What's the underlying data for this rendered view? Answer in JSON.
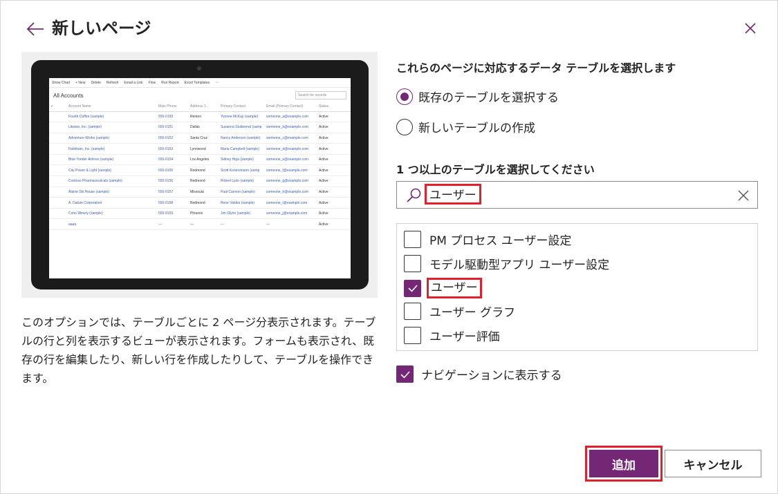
{
  "dialog": {
    "title": "新しいページ"
  },
  "preview": {
    "toolbar": [
      "Show Chart",
      "+ New",
      "Delete",
      "Refresh",
      "Email a Link",
      "Flow",
      "Run Report",
      "Excel Templates",
      "···"
    ],
    "view_title": "All Accounts",
    "search_placeholder": "Search for records",
    "columns": [
      "Account Name",
      "Main Phone",
      "Address 1...",
      "Primary Contact",
      "Email (Primary Contact)",
      "Status"
    ],
    "rows": [
      [
        "Fourth Coffee (sample)",
        "555-0150",
        "Renton",
        "Yvonne McKay (sample)",
        "someone_a@example.com",
        "Active"
      ],
      [
        "Litware, Inc. (sample)",
        "555-0151",
        "Dallas",
        "Susanna Stubberod (samp",
        "someone_b@example.com",
        "Active"
      ],
      [
        "Adventure Works (sample)",
        "555-0152",
        "Santa Cruz",
        "Nancy Anderson (sample)",
        "someone_c@example.com",
        "Active"
      ],
      [
        "Fabrikam, Inc. (sample)",
        "555-0153",
        "Lynnwood",
        "Maria Campbell (sample)",
        "someone_d@example.com",
        "Active"
      ],
      [
        "Blue Yonder Airlines (sample)",
        "555-0154",
        "Los Angeles",
        "Sidney Higa (sample)",
        "someone_e@example.com",
        "Active"
      ],
      [
        "City Power & Light (sample)",
        "555-0155",
        "Redmond",
        "Scott Konersmann (samp",
        "someone_f@example.com",
        "Active"
      ],
      [
        "Contoso Pharmaceuticals (sample)",
        "555-0156",
        "Redmond",
        "Robert Lyon (sample)",
        "someone_g@example.com",
        "Active"
      ],
      [
        "Alpine Ski House (sample)",
        "555-0157",
        "Missoula",
        "Paul Cannon (sample)",
        "someone_h@example.com",
        "Active"
      ],
      [
        "A. Datum Corporation",
        "555-0158",
        "Redmond",
        "Rene Valdes (sample)",
        "someone_i@example.com",
        "Active"
      ],
      [
        "Coho Winery (sample)",
        "555-0159",
        "Phoenix",
        "Jim Glynn (sample)",
        "someone_j@example.com",
        "Active"
      ],
      [
        "aaaa",
        "---",
        "---",
        "---",
        "---",
        "Active"
      ]
    ]
  },
  "description": "このオプションでは、テーブルごとに 2 ページ分表示されます。テーブルの行と列を表示するビューが表示されます。フォームも表示され、既存の行を編集したり、新しい行を作成したりして、テーブルを操作できます。",
  "data_source": {
    "heading": "これらのページに対応するデータ テーブルを選択します",
    "options": [
      {
        "label": "既存のテーブルを選択する",
        "selected": true
      },
      {
        "label": "新しいテーブルの作成",
        "selected": false
      }
    ]
  },
  "tables": {
    "heading": "1 つ以上のテーブルを選択してください",
    "search_value": "ユーザー",
    "items": [
      {
        "label": "PM プロセス ユーザー設定",
        "checked": false
      },
      {
        "label": "モデル駆動型アプリ ユーザー設定",
        "checked": false
      },
      {
        "label": "ユーザー",
        "checked": true
      },
      {
        "label": "ユーザー グラフ",
        "checked": false
      },
      {
        "label": "ユーザー評価",
        "checked": false
      }
    ]
  },
  "navigation": {
    "label": "ナビゲーションに表示する",
    "checked": true
  },
  "footer": {
    "add_label": "追加",
    "cancel_label": "キャンセル"
  },
  "colors": {
    "accent": "#742774",
    "highlight": "#e0202c"
  }
}
